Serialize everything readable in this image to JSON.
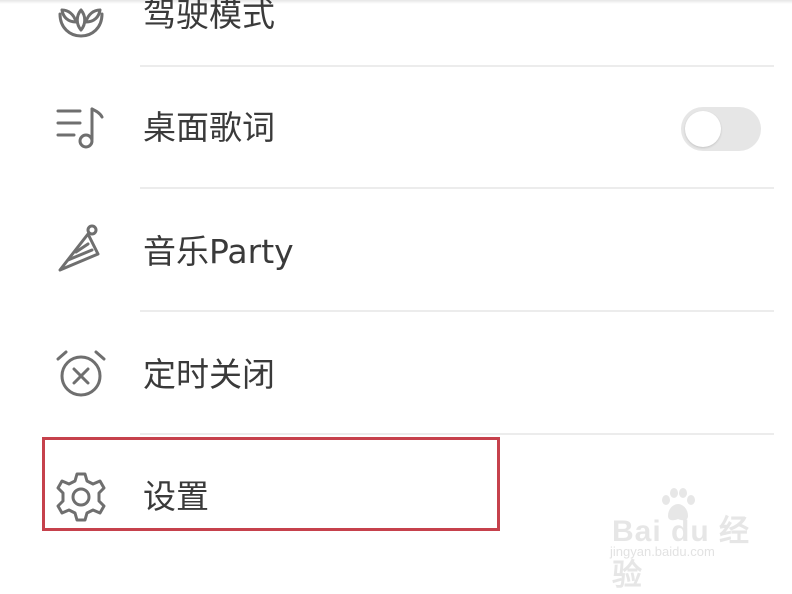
{
  "menu": {
    "items": [
      {
        "label": "驾驶模式",
        "icon": "driving-mode-icon"
      },
      {
        "label": "桌面歌词",
        "icon": "lyrics-icon",
        "toggle": {
          "on": false
        }
      },
      {
        "label": "音乐Party",
        "icon": "party-hat-icon"
      },
      {
        "label": "定时关闭",
        "icon": "alarm-clock-icon"
      },
      {
        "label": "设置",
        "icon": "gear-icon"
      }
    ]
  },
  "colors": {
    "highlight": "#c6414c",
    "icon": "#6f6f6f",
    "text": "#3a3a3a",
    "divider": "#ececec",
    "toggle_off": "#e6e6e6"
  },
  "watermark": {
    "brand": "Bai du 经验",
    "url": "jingyan.baidu.com"
  }
}
